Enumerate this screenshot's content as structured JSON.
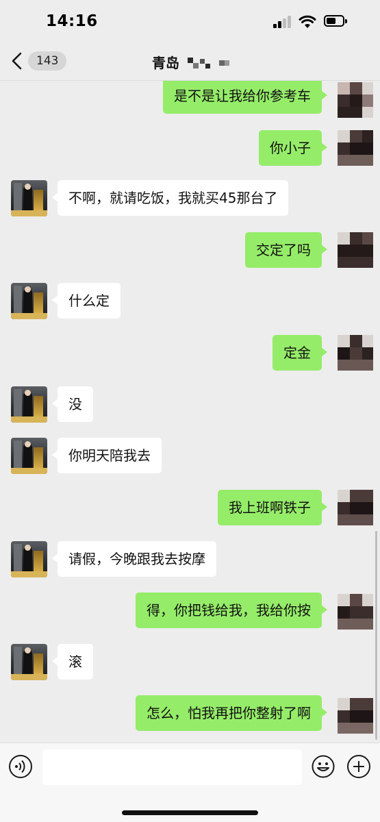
{
  "status_bar": {
    "time": "14:16"
  },
  "nav": {
    "unread_count": "143",
    "title": "青岛",
    "back_icon": "chevron-left-icon"
  },
  "messages": [
    {
      "side": "out",
      "text": "是不是让我给你参考车"
    },
    {
      "side": "out",
      "text": "你小子"
    },
    {
      "side": "in",
      "text": "不啊，就请吃饭，我就买45那台了"
    },
    {
      "side": "out",
      "text": "交定了吗"
    },
    {
      "side": "in",
      "text": "什么定"
    },
    {
      "side": "out",
      "text": "定金"
    },
    {
      "side": "in",
      "text": "没"
    },
    {
      "side": "in",
      "text": "你明天陪我去"
    },
    {
      "side": "out",
      "text": "我上班啊铁子"
    },
    {
      "side": "in",
      "text": "请假，今晚跟我去按摩"
    },
    {
      "side": "out",
      "text": "得，你把钱给我，我给你按"
    },
    {
      "side": "in",
      "text": "滚"
    },
    {
      "side": "out",
      "text": "怎么，怕我再把你整射了啊"
    }
  ],
  "input_bar": {
    "voice_icon": "voice-icon",
    "emoji_icon": "emoji-icon",
    "plus_icon": "plus-icon",
    "input_value": ""
  },
  "colors": {
    "outgoing_bubble": "#95ec69",
    "incoming_bubble": "#ffffff",
    "background": "#ededed"
  }
}
